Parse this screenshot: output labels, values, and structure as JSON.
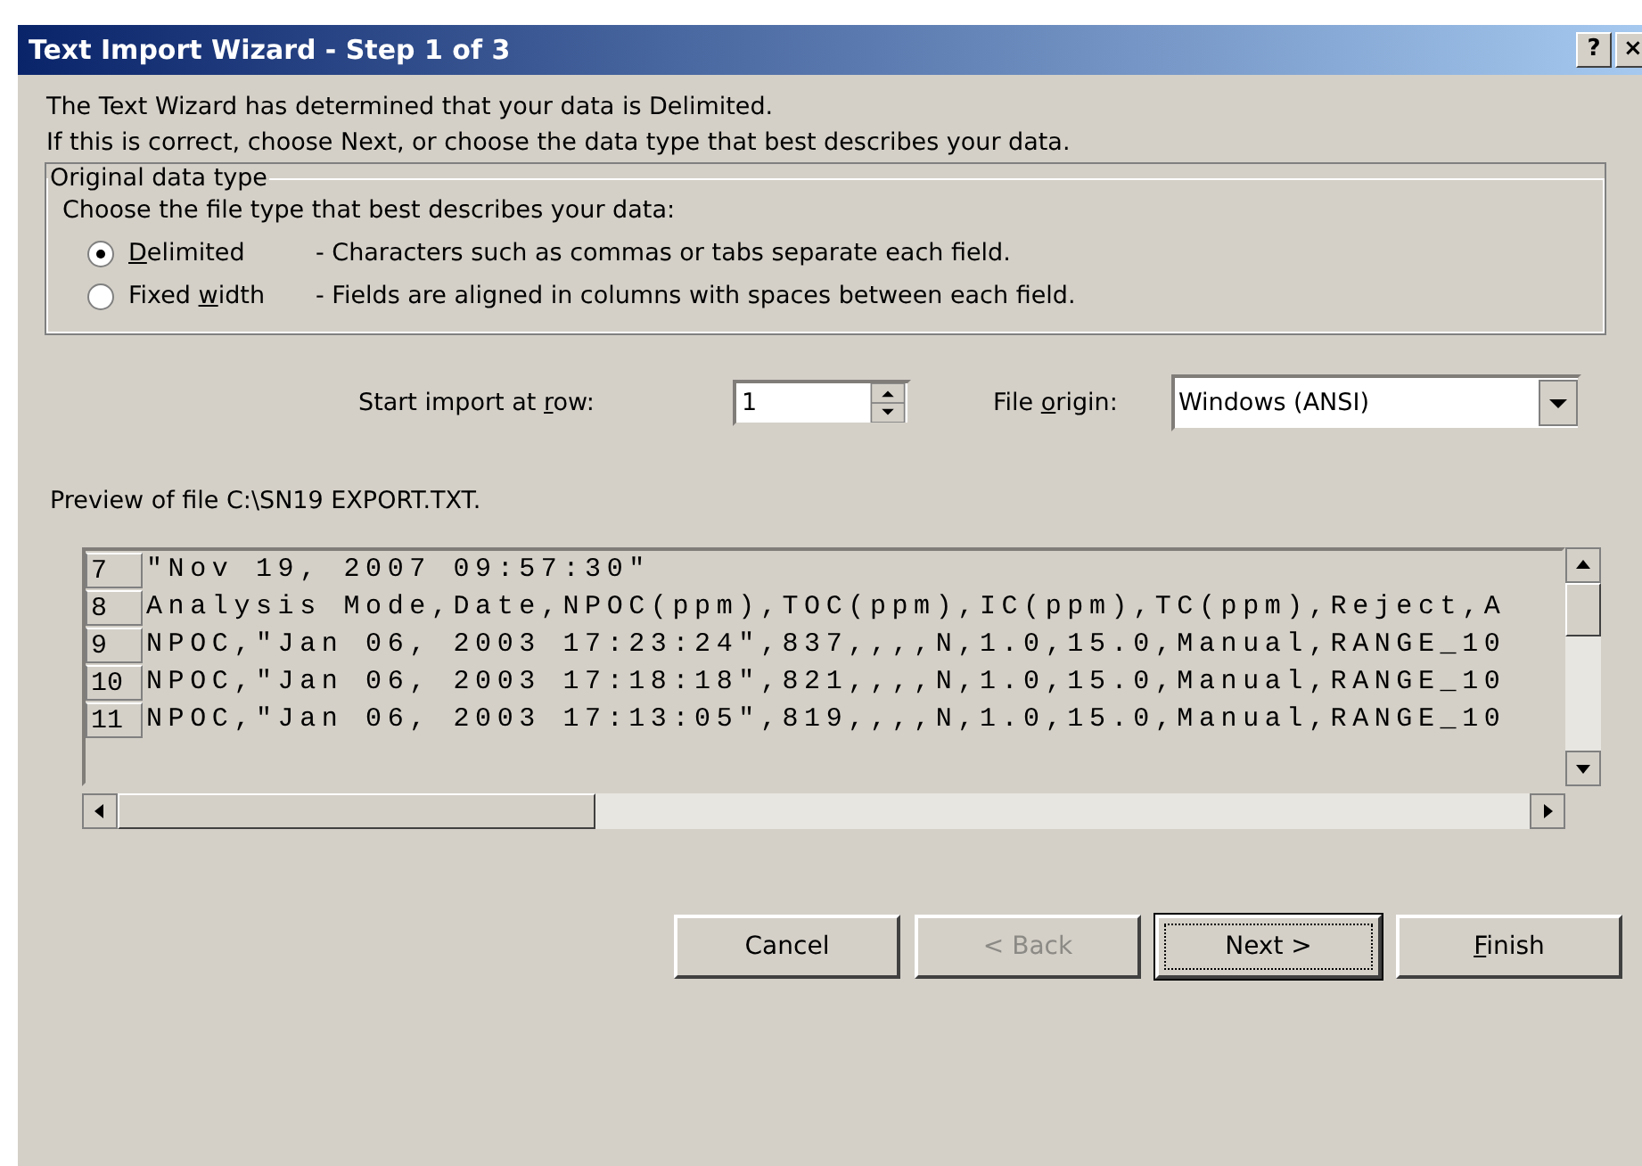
{
  "window": {
    "title": "Text Import Wizard - Step 1 of 3",
    "help_glyph": "?",
    "close_glyph": "×"
  },
  "intro": [
    "The Text Wizard has determined that your data is Delimited.",
    "If this is correct, choose Next, or choose the data type that best describes your data."
  ],
  "data_type_group": {
    "legend": "Original data type",
    "prompt": "Choose the file type that best describes your data:",
    "options": [
      {
        "label": {
          "key": "D",
          "post": "elimited"
        },
        "description": "- Characters such as commas or tabs separate each field.",
        "selected": true
      },
      {
        "label": {
          "pre": "Fixed ",
          "key": "w",
          "post": "idth"
        },
        "description": "- Fields are aligned in columns with spaces between each field.",
        "selected": false
      }
    ]
  },
  "start_row": {
    "label": {
      "pre": "Start import at ",
      "key": "r",
      "post": "ow:"
    },
    "value": "1"
  },
  "file_origin": {
    "label": {
      "pre": "File ",
      "key": "o",
      "post": "rigin:"
    },
    "value": "Windows (ANSI)"
  },
  "preview": {
    "caption": "Preview of file C:\\SN19 EXPORT.TXT.",
    "rows": [
      {
        "number": "7",
        "text": "\"Nov 19, 2007 09:57:30\""
      },
      {
        "number": "8",
        "text": "Analysis Mode,Date,NPOC(ppm),TOC(ppm),IC(ppm),TC(ppm),Reject,A"
      },
      {
        "number": "9",
        "text": "NPOC,\"Jan 06, 2003 17:23:24\",837,,,,N,1.0,15.0,Manual,RANGE_10"
      },
      {
        "number": "10",
        "text": "NPOC,\"Jan 06, 2003 17:18:18\",821,,,,N,1.0,15.0,Manual,RANGE_10"
      },
      {
        "number": "11",
        "text": "NPOC,\"Jan 06, 2003 17:13:05\",819,,,,N,1.0,15.0,Manual,RANGE_10"
      }
    ]
  },
  "buttons": [
    {
      "label": {
        "post": "Cancel"
      },
      "disabled": false,
      "default": false
    },
    {
      "label": {
        "post": "< Back"
      },
      "disabled": true,
      "default": false
    },
    {
      "label": {
        "post": "Next >"
      },
      "disabled": false,
      "default": true
    },
    {
      "label": {
        "key": "F",
        "post": "inish"
      },
      "disabled": false,
      "default": false
    }
  ]
}
